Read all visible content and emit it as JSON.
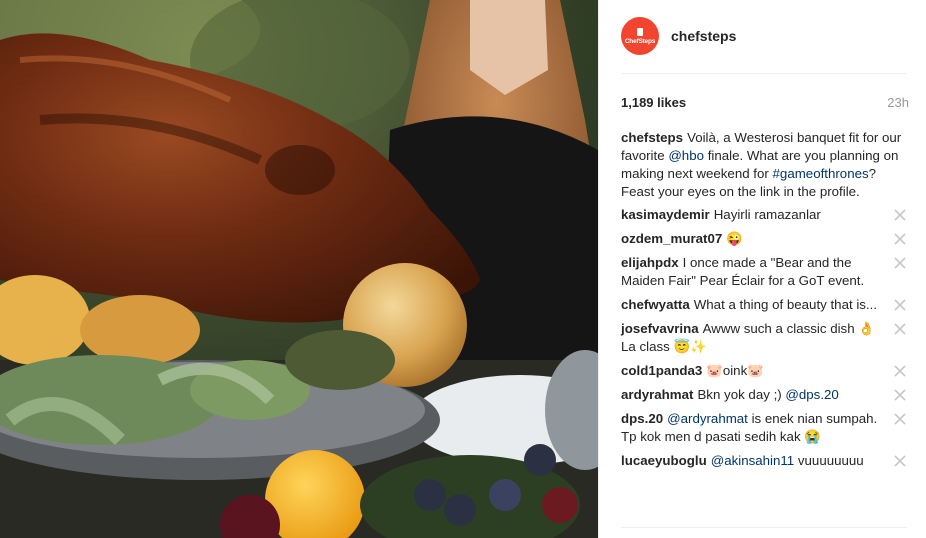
{
  "post": {
    "photo_alt": "",
    "account": {
      "username": "chefsteps",
      "avatar_text": "ChefSteps"
    },
    "likes": "1,189 likes",
    "time": "23h",
    "caption": {
      "user": "chefsteps",
      "parts": [
        {
          "text": "Voilà, a Westerosi banquet fit for our favorite "
        },
        {
          "text": "@hbo",
          "link": true
        },
        {
          "text": " finale. What are you planning on making next weekend for "
        },
        {
          "text": "#gameofthrones",
          "link": true
        },
        {
          "text": "? Feast your eyes on the link in the profile."
        }
      ]
    },
    "comments": [
      {
        "user": "kasimaydemir",
        "parts": [
          {
            "text": "Hayirli ramazanlar"
          }
        ]
      },
      {
        "user": "ozdem_murat07",
        "parts": [
          {
            "text": "😜"
          }
        ]
      },
      {
        "user": "elijahpdx",
        "parts": [
          {
            "text": "I once made a \"Bear and the Maiden Fair\" Pear Éclair for a GoT event."
          }
        ]
      },
      {
        "user": "chefwyatta",
        "parts": [
          {
            "text": "What a thing of beauty that is..."
          }
        ]
      },
      {
        "user": "josefvavrina",
        "parts": [
          {
            "text": "Awww such a classic dish 👌La class 😇✨"
          }
        ]
      },
      {
        "user": "cold1panda3",
        "parts": [
          {
            "text": "🐷oink🐷"
          }
        ]
      },
      {
        "user": "ardyrahmat",
        "parts": [
          {
            "text": "Bkn yok day ;) "
          },
          {
            "text": "@dps.20",
            "link": true
          }
        ]
      },
      {
        "user": "dps.20",
        "parts": [
          {
            "text": "@ardyrahmat",
            "link": true
          },
          {
            "text": " is enek nian sumpah. Tp kok men d pasati sedih kak 😭"
          }
        ]
      },
      {
        "user": "lucaeyuboglu",
        "parts": [
          {
            "text": "@akinsahin11",
            "link": true
          },
          {
            "text": " vuuuuuuuu"
          }
        ]
      }
    ],
    "icons": {
      "delete": "close-icon"
    },
    "colors": {
      "avatar": "#f1452f",
      "link": "#003569",
      "muted": "#999999"
    }
  }
}
